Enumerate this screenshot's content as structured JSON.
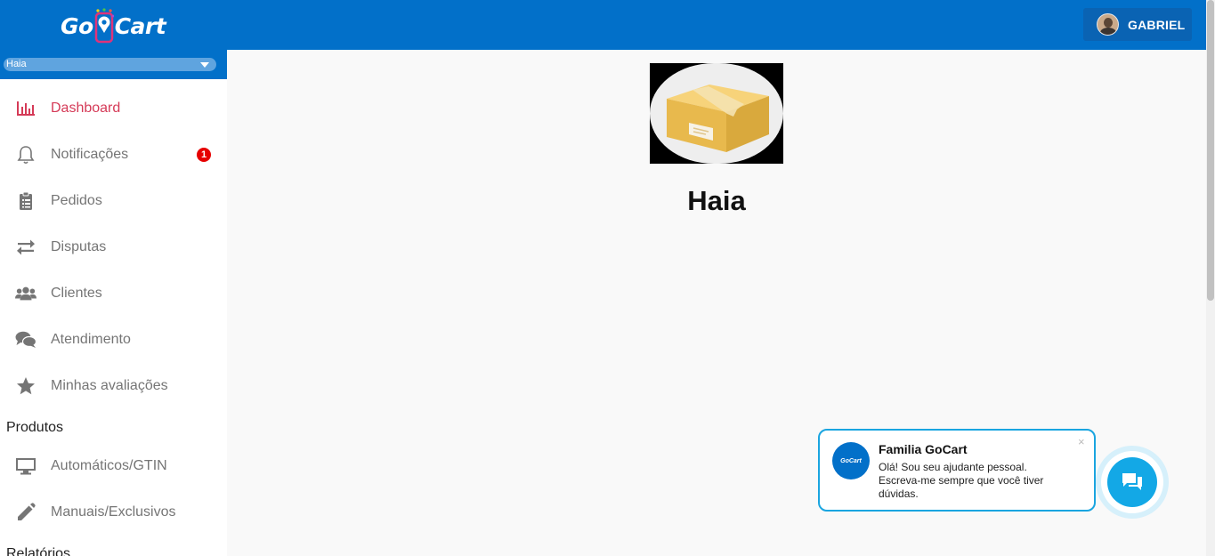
{
  "header": {
    "logo_left": "Go",
    "logo_right": "Cart",
    "user_name": "GABRIEL"
  },
  "store_selector": {
    "selected": "Haia"
  },
  "sidebar": {
    "items": [
      {
        "label": "Dashboard",
        "icon": "bar-chart-icon",
        "active": true
      },
      {
        "label": "Notificações",
        "icon": "bell-icon",
        "badge": "1"
      },
      {
        "label": "Pedidos",
        "icon": "clipboard-icon"
      },
      {
        "label": "Disputas",
        "icon": "swap-arrows-icon"
      },
      {
        "label": "Clientes",
        "icon": "users-icon"
      },
      {
        "label": "Atendimento",
        "icon": "chat-bubbles-icon"
      },
      {
        "label": "Minhas avaliações",
        "icon": "star-icon"
      }
    ],
    "section_produtos": "Produtos",
    "produtos_items": [
      {
        "label": "Automáticos/GTIN",
        "icon": "monitor-icon"
      },
      {
        "label": "Manuais/Exclusivos",
        "icon": "pencil-icon"
      }
    ],
    "section_relatorios": "Relatórios"
  },
  "main": {
    "store_image": "box-icon",
    "store_name": "Haia"
  },
  "chat_widget": {
    "avatar_text": "GoCart",
    "title": "Familia GoCart",
    "line1": "Olá! Sou seu ajudante pessoal.",
    "line2": "Escreva-me sempre que você tiver",
    "line3": "dúvidas.",
    "close_symbol": "×"
  },
  "colors": {
    "primary": "#0270c9",
    "active": "#d53a57",
    "badge": "#e60000",
    "chat_accent": "#13a8e6"
  }
}
